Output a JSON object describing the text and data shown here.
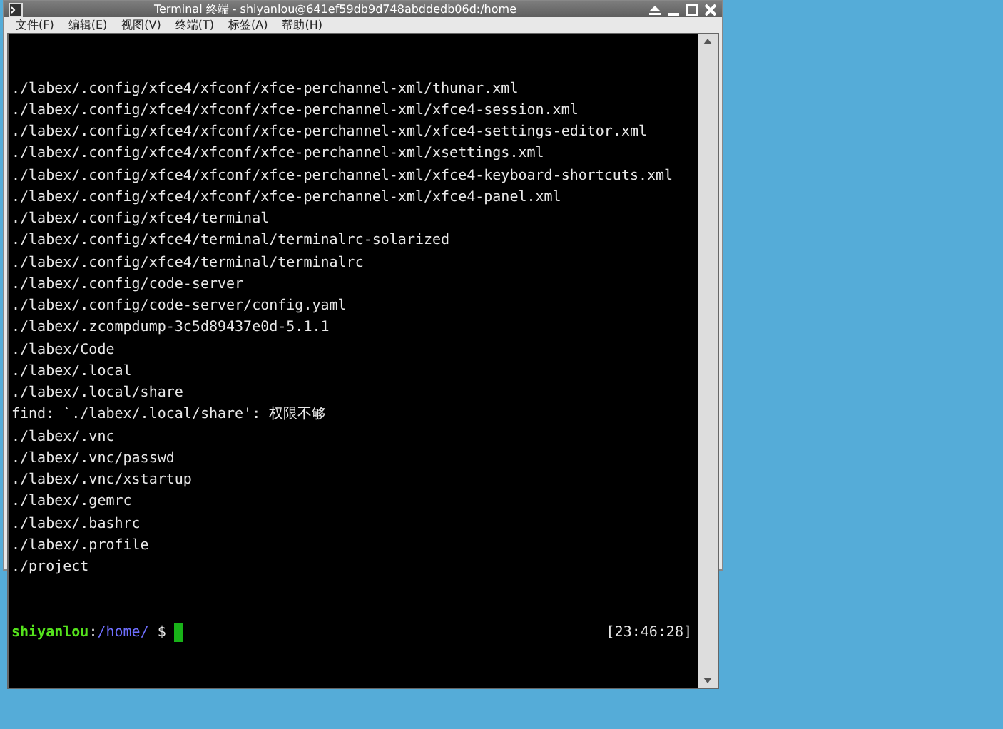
{
  "window": {
    "title": "Terminal 终端 - shiyanlou@641ef59db9d748abddedb06d:/home"
  },
  "menu": [
    "文件(F)",
    "编辑(E)",
    "视图(V)",
    "终端(T)",
    "标签(A)",
    "帮助(H)"
  ],
  "lines": [
    "./labex/.config/xfce4/xfconf/xfce-perchannel-xml/thunar.xml",
    "./labex/.config/xfce4/xfconf/xfce-perchannel-xml/xfce4-session.xml",
    "./labex/.config/xfce4/xfconf/xfce-perchannel-xml/xfce4-settings-editor.xml",
    "./labex/.config/xfce4/xfconf/xfce-perchannel-xml/xsettings.xml",
    "./labex/.config/xfce4/xfconf/xfce-perchannel-xml/xfce4-keyboard-shortcuts.xml",
    "./labex/.config/xfce4/xfconf/xfce-perchannel-xml/xfce4-panel.xml",
    "./labex/.config/xfce4/terminal",
    "./labex/.config/xfce4/terminal/terminalrc-solarized",
    "./labex/.config/xfce4/terminal/terminalrc",
    "./labex/.config/code-server",
    "./labex/.config/code-server/config.yaml",
    "./labex/.zcompdump-3c5d89437e0d-5.1.1",
    "./labex/Code",
    "./labex/.local",
    "./labex/.local/share",
    "find: `./labex/.local/share': 权限不够",
    "./labex/.vnc",
    "./labex/.vnc/passwd",
    "./labex/.vnc/xstartup",
    "./labex/.gemrc",
    "./labex/.bashrc",
    "./labex/.profile",
    "./project"
  ],
  "prompt": {
    "user": "shiyanlou",
    "separator": ":",
    "path": "/home/",
    "symbol": "$",
    "time": "[23:46:28]"
  }
}
